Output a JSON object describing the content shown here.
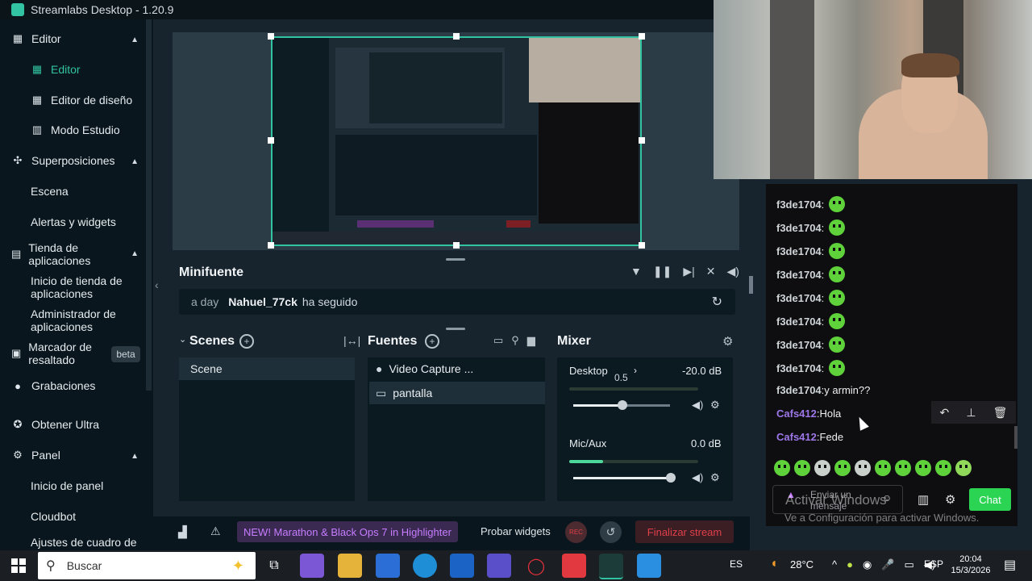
{
  "window": {
    "title": "Streamlabs Desktop - 1.20.9"
  },
  "sidebar": {
    "sections": [
      {
        "label": "Editor",
        "icon": "editor-icon"
      },
      {
        "label": "Superposiciones",
        "icon": "overlays-icon"
      },
      {
        "label": "Tienda de aplicaciones",
        "icon": "store-icon"
      },
      {
        "label": "Marcador de resaltado",
        "icon": "highlighter-icon",
        "badge": "beta"
      },
      {
        "label": "Grabaciones",
        "icon": "recordings-icon"
      },
      {
        "label": "Obtener Ultra",
        "icon": "ultra-icon"
      },
      {
        "label": "Panel",
        "icon": "panel-icon"
      }
    ],
    "editor_items": [
      "Editor",
      "Editor de diseño",
      "Modo Estudio"
    ],
    "overlay_items": [
      "Escena",
      "Alertas y widgets"
    ],
    "store_items": [
      "Inicio de tienda de aplicaciones",
      "Administrador de aplicaciones"
    ],
    "panel_items": [
      "Inicio de panel",
      "Cloudbot",
      "Ajustes de cuadro de"
    ]
  },
  "minifeed": {
    "title": "Minifuente",
    "event": {
      "time": "a day",
      "user": "Nahuel_77ck",
      "action": "ha seguido"
    }
  },
  "scenes": {
    "title": "Scenes",
    "items": [
      "Scene"
    ]
  },
  "sources": {
    "title": "Fuentes",
    "items": [
      "Video Capture ...",
      "pantalla"
    ]
  },
  "mixer": {
    "title": "Mixer",
    "channels": [
      {
        "name": "Desktop",
        "db": "-20.0 dB",
        "tooltip": "0.5",
        "level": 0.5
      },
      {
        "name": "Mic/Aux",
        "db": "0.0 dB",
        "level": 1.0
      }
    ]
  },
  "footer": {
    "highlighter_banner": "NEW! Marathon & Black Ops 7 in Highlighter",
    "test_widgets": "Probar widgets",
    "rec": "REC",
    "end_stream": "Finalizar stream"
  },
  "chat": {
    "messages": [
      {
        "user": "f3de1704",
        "text": "",
        "emote": true,
        "user_color": "#cfd5d9"
      },
      {
        "user": "f3de1704",
        "text": "",
        "emote": true,
        "user_color": "#cfd5d9"
      },
      {
        "user": "f3de1704",
        "text": "",
        "emote": true,
        "user_color": "#cfd5d9"
      },
      {
        "user": "f3de1704",
        "text": "",
        "emote": true,
        "user_color": "#cfd5d9"
      },
      {
        "user": "f3de1704",
        "text": "",
        "emote": true,
        "user_color": "#cfd5d9"
      },
      {
        "user": "f3de1704",
        "text": "",
        "emote": true,
        "user_color": "#cfd5d9"
      },
      {
        "user": "f3de1704",
        "text": "",
        "emote": true,
        "user_color": "#cfd5d9"
      },
      {
        "user": "f3de1704",
        "text": "",
        "emote": true,
        "user_color": "#cfd5d9"
      },
      {
        "user": "f3de1704",
        "text": "y armin??",
        "emote": false,
        "user_color": "#cfd5d9"
      },
      {
        "user": "Cafs412",
        "text": "Hola",
        "emote": false,
        "user_color": "#9d77e8"
      },
      {
        "user": "Cafs412",
        "text": "Fede",
        "emote": false,
        "user_color": "#9d77e8"
      }
    ],
    "input_placeholder": "Enviar un mensaje",
    "send_label": "Chat"
  },
  "watermark": {
    "line1": "Activar Windows",
    "line2": "Ve a Configuración para activar Windows."
  },
  "taskbar": {
    "search_placeholder": "Buscar",
    "lang_left": "ES",
    "temperature": "28°C",
    "lang": "ESP",
    "time": "20:04",
    "date": "15/3/2026"
  },
  "colors": {
    "accent": "#31c3a2",
    "danger": "#e0404a",
    "chat_green": "#2cd454",
    "highlighter_purple": "#c77dff"
  }
}
